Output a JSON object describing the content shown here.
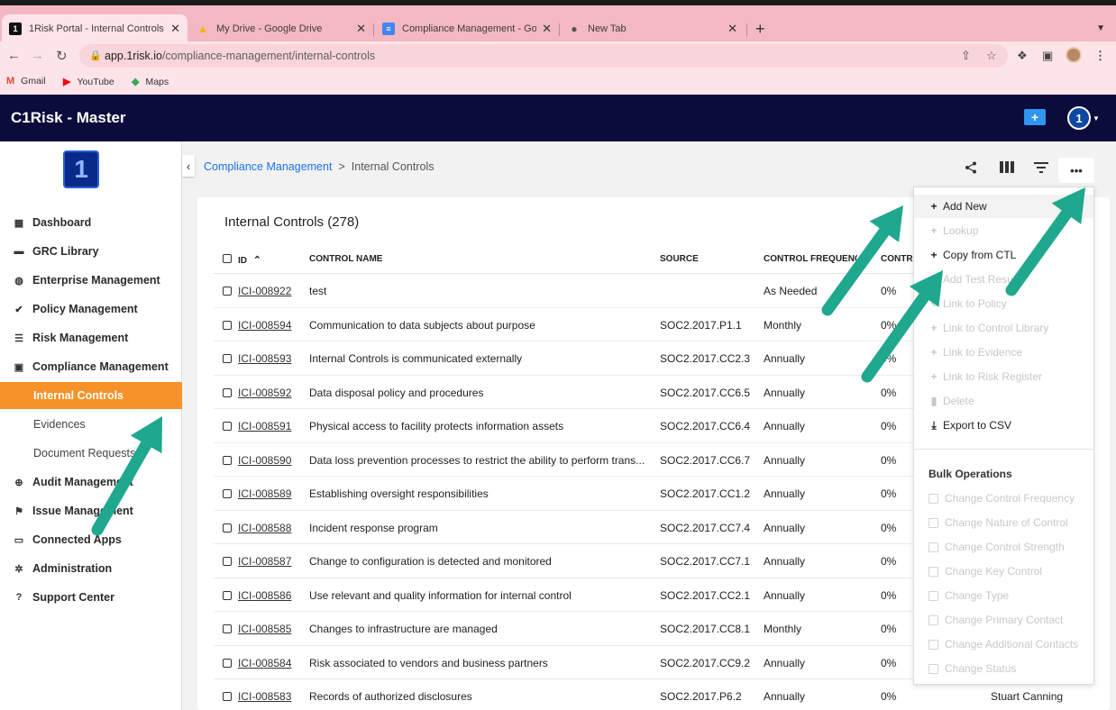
{
  "browser": {
    "tabs": [
      {
        "label": "1Risk Portal - Internal Controls",
        "close": "✕",
        "favicon": "1",
        "favicon_color": "#111111"
      },
      {
        "label": "My Drive - Google Drive",
        "close": "✕",
        "favicon": "▲",
        "favicon_color": "#f4b400"
      },
      {
        "label": "Compliance Management - Goo",
        "close": "✕",
        "favicon": "≡",
        "favicon_color": "#4285f4"
      },
      {
        "label": "New Tab",
        "close": "✕",
        "favicon": "●",
        "favicon_color": "#555555"
      }
    ],
    "new_tab": "+",
    "url_host": "app.1risk.io",
    "url_path": "/compliance-management/internal-controls",
    "bookmarks": [
      {
        "label": "Gmail",
        "icon": "M",
        "color": "#ea4335"
      },
      {
        "label": "YouTube",
        "icon": "▶",
        "color": "#ff0000"
      },
      {
        "label": "Maps",
        "icon": "◆",
        "color": "#34a853"
      }
    ]
  },
  "app": {
    "title": "C1Risk - Master",
    "user_initial": "1",
    "logo_glyph": "1"
  },
  "sidebar": {
    "items": [
      {
        "label": "Dashboard",
        "icon": "dashboard-icon",
        "glyph": "▦"
      },
      {
        "label": "GRC Library",
        "icon": "book-icon",
        "glyph": "▬"
      },
      {
        "label": "Enterprise Management",
        "icon": "globe-icon",
        "glyph": "◍"
      },
      {
        "label": "Policy Management",
        "icon": "check-icon",
        "glyph": "✔"
      },
      {
        "label": "Risk Management",
        "icon": "list-icon",
        "glyph": "☰"
      },
      {
        "label": "Compliance Management",
        "icon": "clipboard-icon",
        "glyph": "▣"
      },
      {
        "label": "Audit Management",
        "icon": "crosshair-icon",
        "glyph": "⊕"
      },
      {
        "label": "Issue Management",
        "icon": "flag-icon",
        "glyph": "⚑"
      },
      {
        "label": "Connected Apps",
        "icon": "apps-icon",
        "glyph": "▭"
      },
      {
        "label": "Administration",
        "icon": "gear-icon",
        "glyph": "✲"
      },
      {
        "label": "Support Center",
        "icon": "help-icon",
        "glyph": "?"
      }
    ],
    "subitems": [
      {
        "label": "Internal Controls"
      },
      {
        "label": "Evidences"
      },
      {
        "label": "Document Requests"
      }
    ],
    "active_color": "#f7922a"
  },
  "breadcrumb": {
    "parent": "Compliance Management",
    "separator": ">",
    "current": "Internal Controls"
  },
  "toolbar": {
    "share": "share-icon",
    "columns": "columns-icon",
    "filter": "filter-icon",
    "more": "•••"
  },
  "table": {
    "title": "Internal Controls (278)",
    "columns": [
      "ID",
      "CONTROL NAME",
      "SOURCE",
      "CONTROL FREQUENCY",
      "CONTROL"
    ],
    "sort_glyph": "⌃",
    "rows": [
      {
        "id": "ICI-008922",
        "name": "test",
        "source": "",
        "frequency": "As Needed",
        "pct": "0%"
      },
      {
        "id": "ICI-008594",
        "name": "Communication to data subjects about purpose",
        "source": "SOC2.2017.P1.1",
        "frequency": "Monthly",
        "pct": "0%"
      },
      {
        "id": "ICI-008593",
        "name": "Internal Controls is communicated externally",
        "source": "SOC2.2017.CC2.3",
        "frequency": "Annually",
        "pct": "0%"
      },
      {
        "id": "ICI-008592",
        "name": "Data disposal policy and procedures",
        "source": "SOC2.2017.CC6.5",
        "frequency": "Annually",
        "pct": "0%"
      },
      {
        "id": "ICI-008591",
        "name": "Physical access to facility protects information assets",
        "source": "SOC2.2017.CC6.4",
        "frequency": "Annually",
        "pct": "0%"
      },
      {
        "id": "ICI-008590",
        "name": "Data loss prevention processes to restrict the ability to perform trans...",
        "source": "SOC2.2017.CC6.7",
        "frequency": "Annually",
        "pct": "0%"
      },
      {
        "id": "ICI-008589",
        "name": "Establishing oversight responsibilities",
        "source": "SOC2.2017.CC1.2",
        "frequency": "Annually",
        "pct": "0%"
      },
      {
        "id": "ICI-008588",
        "name": "Incident response program",
        "source": "SOC2.2017.CC7.4",
        "frequency": "Annually",
        "pct": "0%"
      },
      {
        "id": "ICI-008587",
        "name": "Change to configuration is detected and monitored",
        "source": "SOC2.2017.CC7.1",
        "frequency": "Annually",
        "pct": "0%"
      },
      {
        "id": "ICI-008586",
        "name": "Use relevant and quality information for internal control",
        "source": "SOC2.2017.CC2.1",
        "frequency": "Annually",
        "pct": "0%"
      },
      {
        "id": "ICI-008585",
        "name": "Changes to infrastructure are managed",
        "source": "SOC2.2017.CC8.1",
        "frequency": "Monthly",
        "pct": "0%"
      },
      {
        "id": "ICI-008584",
        "name": "Risk associated to vendors and business partners",
        "source": "SOC2.2017.CC9.2",
        "frequency": "Annually",
        "pct": "0%"
      },
      {
        "id": "ICI-008583",
        "name": "Records of authorized disclosures",
        "source": "SOC2.2017.P6.2",
        "frequency": "Annually",
        "pct": "0%"
      }
    ],
    "partial_contact": "Stuart Canning"
  },
  "menu": {
    "items": [
      {
        "label": "Add New",
        "glyph": "+",
        "enabled": true
      },
      {
        "label": "Lookup",
        "glyph": "+",
        "enabled": false
      },
      {
        "label": "Copy from CTL",
        "glyph": "+",
        "enabled": true
      },
      {
        "label": "Add Test Result",
        "glyph": "+",
        "enabled": false
      },
      {
        "label": "Link to Policy",
        "glyph": "+",
        "enabled": false
      },
      {
        "label": "Link to Control Library",
        "glyph": "+",
        "enabled": false
      },
      {
        "label": "Link to Evidence",
        "glyph": "+",
        "enabled": false
      },
      {
        "label": "Link to Risk Register",
        "glyph": "+",
        "enabled": false
      },
      {
        "label": "Delete",
        "glyph": "▮",
        "enabled": false
      },
      {
        "label": "Export to CSV",
        "glyph": "⤓",
        "enabled": true
      }
    ],
    "bulk_heading": "Bulk Operations",
    "bulk_items": [
      "Change Control Frequency",
      "Change Nature of Control",
      "Change Control Strength",
      "Change Key Control",
      "Change Type",
      "Change Primary Contact",
      "Change Additional Contacts",
      "Change Status"
    ]
  },
  "annotation_color": "#1fa88e"
}
